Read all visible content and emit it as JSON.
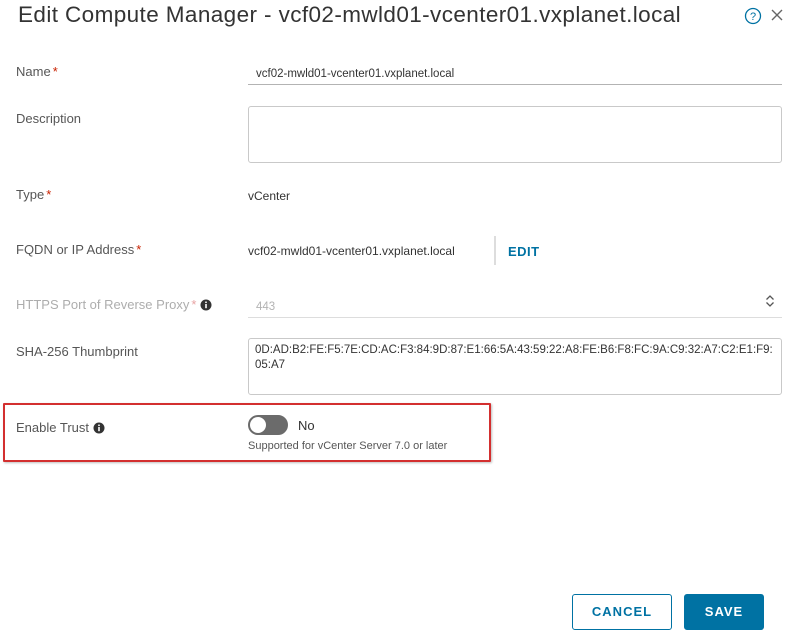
{
  "dialog": {
    "title": "Edit Compute Manager - vcf02-mwld01-vcenter01.vxplanet.local"
  },
  "form": {
    "required_marker": "*",
    "name": {
      "label": "Name",
      "value": "vcf02-mwld01-vcenter01.vxplanet.local"
    },
    "description": {
      "label": "Description",
      "value": ""
    },
    "type": {
      "label": "Type",
      "value": "vCenter"
    },
    "fqdn": {
      "label": "FQDN or IP Address",
      "value": "vcf02-mwld01-vcenter01.vxplanet.local",
      "edit_label": "EDIT"
    },
    "https_port": {
      "label": "HTTPS Port of Reverse Proxy",
      "value": "443"
    },
    "thumbprint": {
      "label": "SHA-256 Thumbprint",
      "value": "0D:AD:B2:FE:F5:7E:CD:AC:F3:84:9D:87:E1:66:5A:43:59:22:A8:FE:B6:F8:FC:9A:C9:32:A7:C2:E1:F9:05:A7"
    },
    "enable_trust": {
      "label": "Enable Trust",
      "state_label": "No",
      "enabled": false,
      "helper": "Supported for vCenter Server 7.0 or later"
    }
  },
  "buttons": {
    "cancel": "CANCEL",
    "save": "SAVE"
  },
  "colors": {
    "accent": "#0072a3",
    "required": "#c92100",
    "highlight": "#d32f2f",
    "toggle_off": "#6b6b6b"
  },
  "icons": {
    "help": "help-circle-icon",
    "close": "close-icon",
    "info": "info-circle-icon",
    "spinner": "up-down-chevron-icon"
  }
}
